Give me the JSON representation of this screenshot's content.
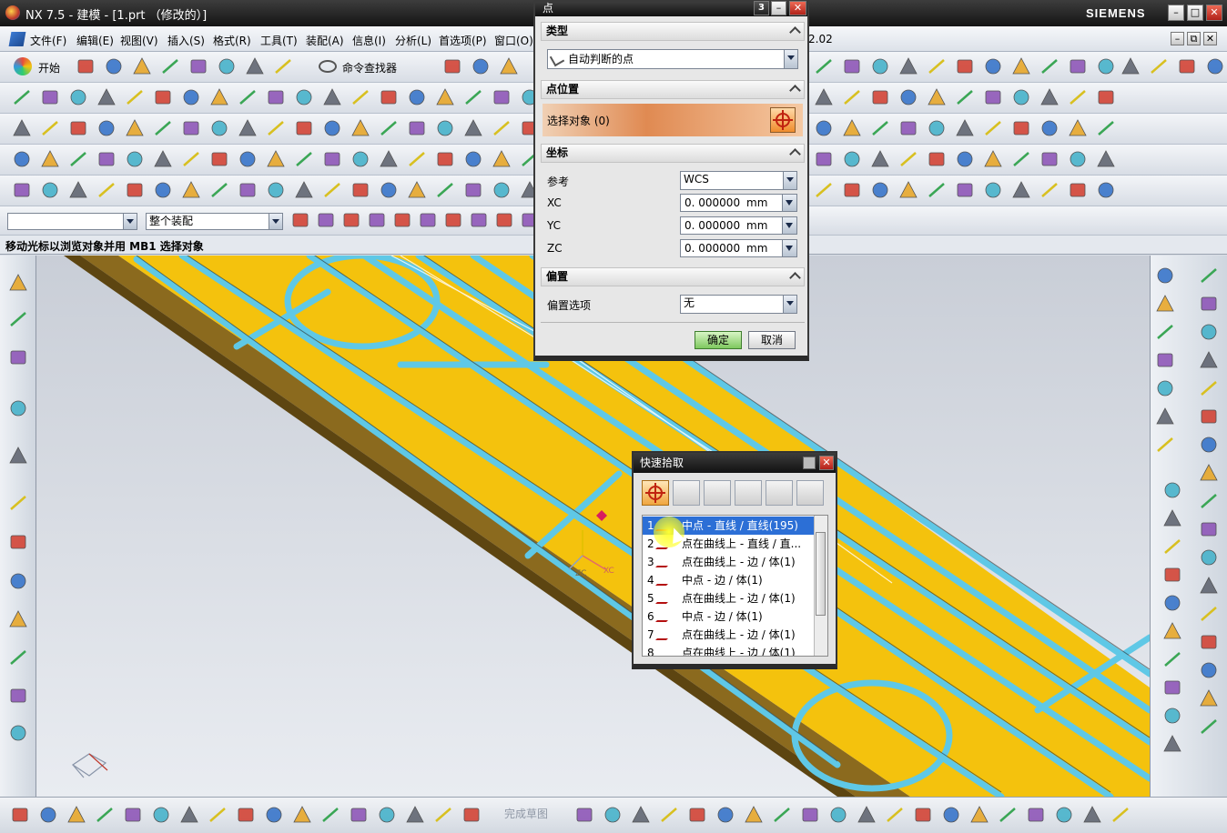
{
  "window": {
    "title": "NX 7.5 - 建模 - [1.prt （修改的）]",
    "brand": "SIEMENS",
    "controls": {
      "minimize": "–",
      "maximize": "□",
      "close": "✕"
    },
    "doc_controls": {
      "minimize": "–",
      "restore": "⧉",
      "close": "✕"
    },
    "version_tail": "2.02"
  },
  "menubar": {
    "items": [
      "文件(F)",
      "编辑(E)",
      "视图(V)",
      "插入(S)",
      "格式(R)",
      "工具(T)",
      "装配(A)",
      "信息(I)",
      "分析(L)",
      "首选项(P)",
      "窗口(O)"
    ]
  },
  "toolbar": {
    "start_label": "开始",
    "command_finder": "命令查找器",
    "filter_value": "",
    "assembly_scope": "整个装配"
  },
  "status": {
    "prompt": "移动光标以浏览对象并用 MB1 选择对象"
  },
  "point_dialog": {
    "title": "点",
    "sections": {
      "type": "类型",
      "point_location": "点位置",
      "coordinates": "坐标",
      "offset": "偏置"
    },
    "type_value": "自动判断的点",
    "select_object": "选择对象 (0)",
    "reference_label": "参考",
    "reference_value": "WCS",
    "xc_label": "XC",
    "yc_label": "YC",
    "zc_label": "ZC",
    "xc_value": "0. 000000",
    "yc_value": "0. 000000",
    "zc_value": "0. 000000",
    "unit": "mm",
    "offset_option_label": "偏置选项",
    "offset_option_value": "无",
    "ok_label": "确定",
    "cancel_label": "取消"
  },
  "quick_pick": {
    "title": "快速拾取",
    "selected_index": 1,
    "items": [
      {
        "num": "1",
        "text": "中点 - 直线 / 直线(195)"
      },
      {
        "num": "2",
        "text": "点在曲线上 - 直线 / 直..."
      },
      {
        "num": "3",
        "text": "点在曲线上 - 边 / 体(1)"
      },
      {
        "num": "4",
        "text": "中点 - 边 / 体(1)"
      },
      {
        "num": "5",
        "text": "点在曲线上 - 边 / 体(1)"
      },
      {
        "num": "6",
        "text": "中点 - 边 / 体(1)"
      },
      {
        "num": "7",
        "text": "点在曲线上 - 边 / 体(1)"
      },
      {
        "num": "8",
        "text": "点在曲线上 - 边 / 体(1)"
      }
    ]
  },
  "viewport": {
    "triad_labels": {
      "zc": "ZC",
      "xc": "XC"
    }
  },
  "bottom_toolbar": {
    "finish_sketch": "完成草图"
  },
  "colors": {
    "part_face": "#f4c20d",
    "part_side": "#8b6a1e",
    "groove": "#5fc8e6",
    "background_top": "#c9ced7",
    "background_bottom": "#e9ecf1",
    "selection": "#2c6fd6"
  }
}
